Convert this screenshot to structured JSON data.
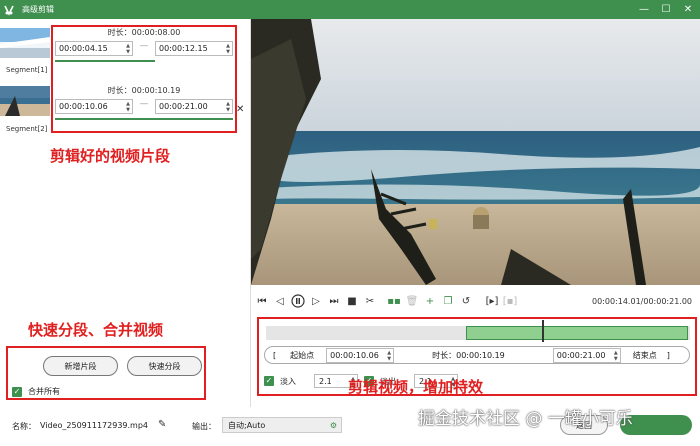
{
  "window": {
    "title": "高级剪辑",
    "minimize": "—",
    "maximize": "☐",
    "close": "✕"
  },
  "segments": [
    {
      "label": "Segment[1]",
      "duration": "时长：00:00:08.00",
      "start": "00:00:04.15",
      "end": "00:00:12.15"
    },
    {
      "label": "Segment[2]",
      "duration": "时长：00:00:10.19",
      "start": "00:00:10.06",
      "end": "00:00:21.00"
    }
  ],
  "annotations": {
    "clipped_segments": "剪辑好的视频片段",
    "split_merge": "快速分段、合并视频",
    "effects": "剪辑视频，增加特效"
  },
  "left_actions": {
    "add_segment": "新增片段",
    "quick_split": "快速分段",
    "merge_all": "合并所有"
  },
  "player": {
    "time": "00:00:14.01/00:00:21.00"
  },
  "range": {
    "start_label": "起始点",
    "start_value": "00:00:10.06",
    "duration": "时长：00:00:10.19",
    "end_value": "00:00:21.00",
    "end_label": "结束点"
  },
  "fade": {
    "in_label": "淡入",
    "in_value": "2.1",
    "out_label": "淡出",
    "out_value": "2.1"
  },
  "bottom": {
    "name_label": "名称：",
    "name_value": "Video_250911172939.mp4",
    "output_label": "输出：",
    "output_value": "自动;Auto",
    "back": "返回"
  },
  "watermark": "掘金技术社区 @ 一罐小可乐",
  "colors": {
    "accent": "#3f8f4f",
    "annotation": "#e02020"
  }
}
